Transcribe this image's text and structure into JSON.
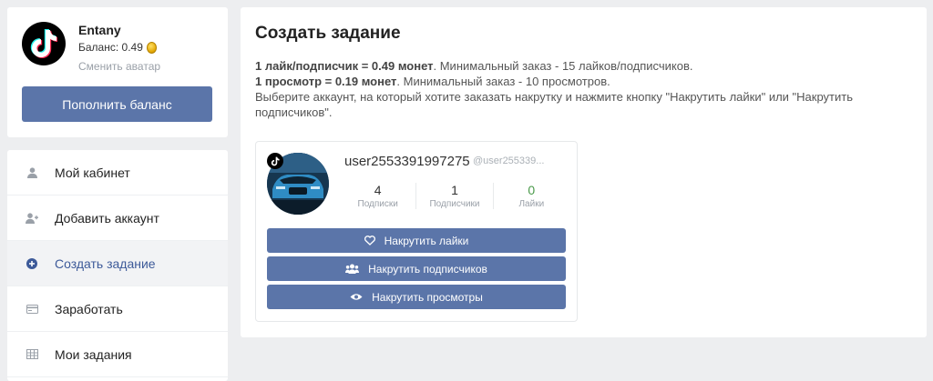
{
  "profile": {
    "name": "Entany",
    "balance_label": "Баланс: 0.49",
    "change_avatar": "Сменить аватар",
    "topup_label": "Пополнить баланс"
  },
  "nav": {
    "items": [
      {
        "label": "Мой кабинет",
        "icon": "user-icon"
      },
      {
        "label": "Добавить аккаунт",
        "icon": "add-user-icon"
      },
      {
        "label": "Создать задание",
        "icon": "plus-circle-icon",
        "active": true
      },
      {
        "label": "Заработать",
        "icon": "card-icon"
      },
      {
        "label": "Мои задания",
        "icon": "table-icon"
      }
    ]
  },
  "main": {
    "title": "Создать задание",
    "line1_bold": "1 лайк/подписчик = 0.49 монет",
    "line1_rest": ". Минимальный заказ - 15 лайков/подписчиков.",
    "line2_bold": "1 просмотр = 0.19 монет",
    "line2_rest": ". Минимальный заказ - 10 просмотров.",
    "line3": "Выберите аккаунт, на который хотите заказать накрутку и нажмите кнопку \"Накрутить лайки\" или \"Накрутить подписчиков\"."
  },
  "account": {
    "username": "user2553391997275",
    "handle": "@user255339...",
    "stats": [
      {
        "value": "4",
        "label": "Подписки"
      },
      {
        "value": "1",
        "label": "Подписчики"
      },
      {
        "value": "0",
        "label": "Лайки"
      }
    ],
    "buttons": {
      "likes": "Накрутить лайки",
      "followers": "Накрутить подписчиков",
      "views": "Накрутить просмотры"
    }
  },
  "colors": {
    "accent": "#5b75a9",
    "active_text": "#3d5a99",
    "background": "#edeef0"
  }
}
